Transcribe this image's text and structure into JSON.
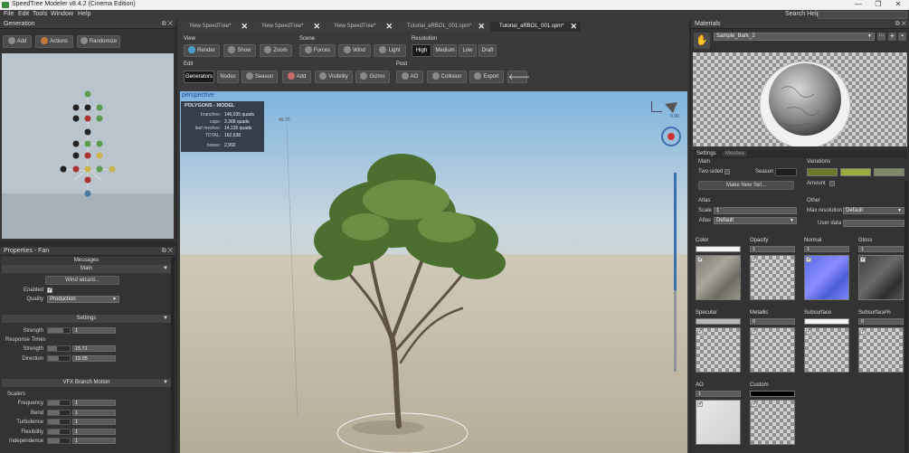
{
  "app": {
    "title": "SpeedTree Modeler v8.4.2 (Cinema Edition)"
  },
  "window_controls": {
    "minimize": "—",
    "maximize": "❐",
    "close": "✕"
  },
  "menu": [
    "File",
    "Edit",
    "Tools",
    "Window",
    "Help"
  ],
  "search": {
    "label": "Search Help:",
    "value": ""
  },
  "generation": {
    "title": "Generation",
    "buttons": {
      "add": "Add",
      "actions": "Actions",
      "randomize": "Randomize"
    }
  },
  "tabs": [
    {
      "label": "New SpeedTree*"
    },
    {
      "label": "New SpeedTree*"
    },
    {
      "label": "New SpeedTree*"
    },
    {
      "label": "Tutorial_aRBOL_001.spm*"
    },
    {
      "label": "Tutorial_aRBOL_001.spm*"
    }
  ],
  "toolbar": {
    "view": {
      "label": "View",
      "render": "Render",
      "show": "Show",
      "zoom": "Zoom"
    },
    "scene": {
      "label": "Scene",
      "forces": "Forces",
      "wind": "Wind",
      "light": "Light"
    },
    "resolution": {
      "label": "Resolution",
      "options": [
        "High",
        "Medium",
        "Low",
        "Draft"
      ],
      "selected": "High"
    },
    "edit": {
      "label": "Edit",
      "generators": "Generators",
      "nodes": "Nodes",
      "season": "Season",
      "add": "Add",
      "visibility": "Visibility",
      "gizmo": "Gizmo"
    },
    "post": {
      "label": "Post",
      "ao": "AO",
      "collision": "Collision",
      "export": "Export"
    }
  },
  "viewport": {
    "label": "perspective",
    "stats": {
      "title": "POLYGONS - MODEL",
      "rows": [
        {
          "name": "branches:",
          "value": "146,035 quads"
        },
        {
          "name": "caps:",
          "value": "2,368 quads"
        },
        {
          "name": "leaf meshes:",
          "value": "14,135 quads"
        },
        {
          "name": "TOTAL:",
          "value": "162,538"
        }
      ],
      "bones_label": "bones:",
      "bones_value": "2,992"
    },
    "height_marker": "46.75",
    "compass_value": "0.90"
  },
  "properties": {
    "title": "Properties - Fan",
    "messages_header": "Messages",
    "main": {
      "header": "Main",
      "wind_wizard": "Wind wizard...",
      "enabled_label": "Enabled",
      "quality_label": "Quality",
      "quality_value": "Production"
    },
    "settings": {
      "header": "Settings",
      "strength_label": "Strength",
      "strength_value": "1",
      "response_times_label": "Response Times",
      "rt_strength_label": "Strength",
      "rt_strength_value": "15.71",
      "rt_direction_label": "Direction",
      "rt_direction_value": "19.05"
    },
    "vfx": {
      "header": "VFX Branch Motion",
      "scalers_label": "Scalers",
      "rows": [
        {
          "label": "Frequency",
          "value": "1"
        },
        {
          "label": "Bend",
          "value": "1"
        },
        {
          "label": "Turbulence",
          "value": "1"
        },
        {
          "label": "Flexibility",
          "value": "1"
        },
        {
          "label": "Independence",
          "value": "1"
        }
      ]
    }
  },
  "materials": {
    "title": "Materials",
    "selected_material": "Sample_Bark_2",
    "tabs": {
      "settings": "Settings",
      "meshes": "Meshes"
    },
    "main_label": "Main",
    "two_sided_label": "Two-sided",
    "season_label": "Season",
    "make_new_set": "Make New Set...",
    "variations_label": "Variations",
    "amount_label": "Amount",
    "atlas_label": "Atlas",
    "scale_label": "Scale",
    "scale_value": "1",
    "atlas_field_label": "Atlas",
    "atlas_value": "Default",
    "other_label": "Other",
    "max_res_label": "Max resolution",
    "max_res_value": "Default",
    "user_data_label": "User data",
    "channels": [
      {
        "label": "Color",
        "value": ""
      },
      {
        "label": "Opacity",
        "value": "1"
      },
      {
        "label": "Normal",
        "value": "1"
      },
      {
        "label": "Gloss",
        "value": "1"
      },
      {
        "label": "Specular",
        "value": ""
      },
      {
        "label": "Metallic",
        "value": "0"
      },
      {
        "label": "Subsurface",
        "value": ""
      },
      {
        "label": "Subsurface%",
        "value": "0"
      },
      {
        "label": "AO",
        "value": "1"
      },
      {
        "label": "Custom",
        "value": ""
      }
    ],
    "variation_colors": [
      "#6b7a2a",
      "#9aae3d",
      "#7e8a6a"
    ]
  }
}
